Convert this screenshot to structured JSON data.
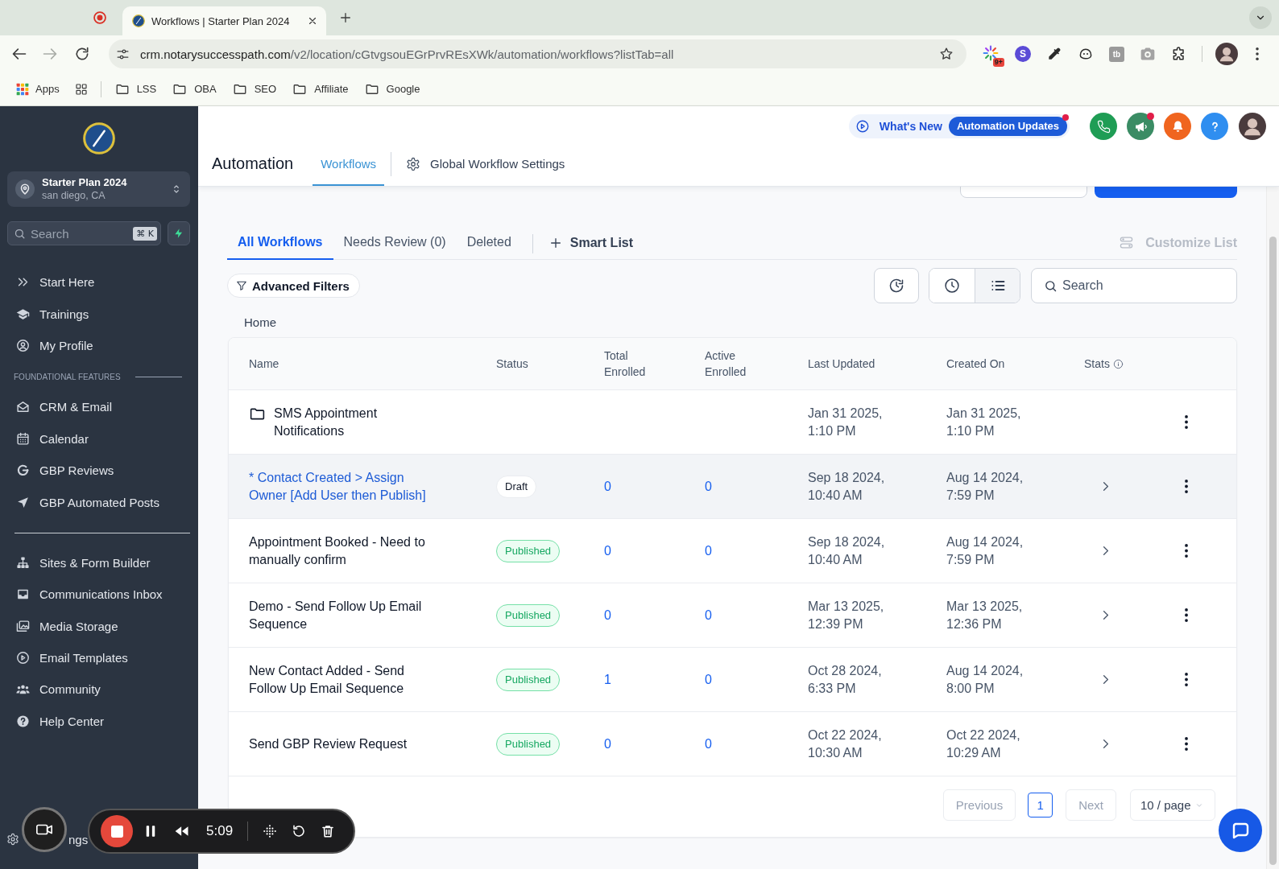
{
  "browser": {
    "tabs": [
      {
        "kind": "recording",
        "selected": false
      },
      {
        "kind": "page",
        "title": "Workflows | Starter Plan 2024",
        "selected": true
      }
    ],
    "address": {
      "host": "crm.notarysuccesspath.com",
      "path": "/v2/location/cGtvgsouEGrPrvREsXWk/automation/workflows?listTab=all"
    },
    "extensions": {
      "badge": "9+",
      "letters": [
        "S",
        "tb"
      ]
    },
    "bookmarks": [
      {
        "kind": "apps",
        "label": "Apps"
      },
      {
        "kind": "grid"
      },
      {
        "kind": "folder",
        "label": "LSS"
      },
      {
        "kind": "folder",
        "label": "OBA"
      },
      {
        "kind": "folder",
        "label": "SEO"
      },
      {
        "kind": "folder",
        "label": "Affiliate"
      },
      {
        "kind": "folder",
        "label": "Google"
      }
    ]
  },
  "sidebar": {
    "account": {
      "name": "Starter Plan 2024",
      "location": "san diego, CA"
    },
    "search": {
      "placeholder": "Search",
      "shortcut": "⌘ K"
    },
    "groups": [
      {
        "items": [
          {
            "label": "Start Here"
          },
          {
            "label": "Trainings"
          },
          {
            "label": "My Profile"
          }
        ]
      },
      {
        "heading": "FOUNDATIONAL FEATURES",
        "items": [
          {
            "label": "CRM & Email"
          },
          {
            "label": "Calendar"
          },
          {
            "label": "GBP Reviews"
          },
          {
            "label": "GBP Automated Posts"
          }
        ]
      },
      {
        "items": [
          {
            "label": "Sites & Form Builder"
          },
          {
            "label": "Communications Inbox"
          },
          {
            "label": "Media Storage"
          },
          {
            "label": "Email Templates"
          },
          {
            "label": "Community"
          },
          {
            "label": "Help Center"
          }
        ]
      }
    ],
    "footer_label": "ngs"
  },
  "header": {
    "whats_new": {
      "label": "What's New",
      "badge": "Automation Updates",
      "has_notification": true
    },
    "actions": [
      {
        "has_notification": false
      },
      {
        "has_notification": true
      },
      {
        "has_notification": false
      },
      {
        "has_notification": false
      }
    ],
    "title": "Automation",
    "tabs": [
      {
        "label": "Workflows",
        "selected": true
      }
    ],
    "settings_link": "Global Workflow Settings"
  },
  "page": {
    "list_tabs": [
      {
        "label": "All Workflows",
        "selected": true
      },
      {
        "label": "Needs Review (0)",
        "selected": false
      },
      {
        "label": "Deleted",
        "selected": false
      }
    ],
    "smart_list": "Smart List",
    "customize_list": {
      "label": "Customize List",
      "disabled": true
    },
    "advanced_filters": "Advanced Filters",
    "view_modes": [
      {
        "selected": false
      },
      {
        "selected": true
      }
    ],
    "search": {
      "placeholder": "Search"
    },
    "breadcrumb": "Home"
  },
  "table": {
    "columns": [
      "Name",
      "Status",
      "Total Enrolled",
      "Active Enrolled",
      "Last Updated",
      "Created On",
      "Stats"
    ],
    "rows": [
      {
        "kind": "folder",
        "name": "SMS Appointment Notifications",
        "last_updated": "Jan 31 2025, 1:10 PM",
        "created_on": "Jan 31 2025, 1:10 PM",
        "highlighted": false
      },
      {
        "kind": "workflow",
        "name": "* Contact Created > Assign Owner [Add User then Publish]",
        "status": {
          "label": "Draft",
          "kind": "draft"
        },
        "total_enrolled": "0",
        "active_enrolled": "0",
        "last_updated": "Sep 18 2024, 10:40 AM",
        "created_on": "Aug 14 2024, 7:59 PM",
        "highlighted": true
      },
      {
        "kind": "workflow",
        "name": "Appointment Booked - Need to manually confirm",
        "status": {
          "label": "Published",
          "kind": "published"
        },
        "total_enrolled": "0",
        "active_enrolled": "0",
        "last_updated": "Sep 18 2024, 10:40 AM",
        "created_on": "Aug 14 2024, 7:59 PM",
        "highlighted": false
      },
      {
        "kind": "workflow",
        "name": "Demo - Send Follow Up Email Sequence",
        "status": {
          "label": "Published",
          "kind": "published"
        },
        "total_enrolled": "0",
        "active_enrolled": "0",
        "last_updated": "Mar 13 2025, 12:39 PM",
        "created_on": "Mar 13 2025, 12:36 PM",
        "highlighted": false
      },
      {
        "kind": "workflow",
        "name": "New Contact Added - Send Follow Up Email Sequence",
        "status": {
          "label": "Published",
          "kind": "published"
        },
        "total_enrolled": "1",
        "active_enrolled": "0",
        "last_updated": "Oct 28 2024, 6:33 PM",
        "created_on": "Aug 14 2024, 8:00 PM",
        "highlighted": false
      },
      {
        "kind": "workflow",
        "name": "Send GBP Review Request",
        "status": {
          "label": "Published",
          "kind": "published"
        },
        "total_enrolled": "0",
        "active_enrolled": "0",
        "last_updated": "Oct 22 2024, 10:30 AM",
        "created_on": "Oct 22 2024, 10:29 AM",
        "highlighted": false
      }
    ],
    "pagination": {
      "previous": {
        "label": "Previous",
        "disabled": true
      },
      "pages": [
        {
          "label": "1",
          "selected": true
        }
      ],
      "next": {
        "label": "Next",
        "disabled": true
      },
      "page_size": "10 / page"
    }
  },
  "recorder": {
    "time": "5:09"
  }
}
